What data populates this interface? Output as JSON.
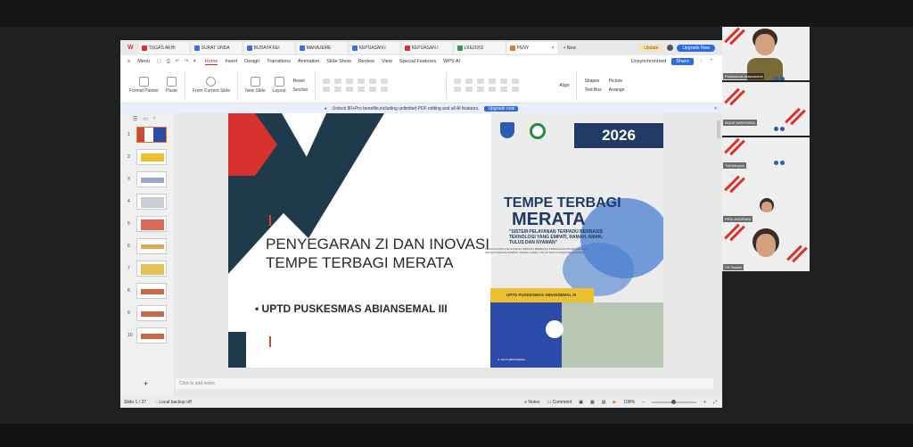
{
  "tabs": [
    {
      "label": "TUGAS AKHI",
      "color": "#d8322e"
    },
    {
      "label": "SURAT UNDA",
      "color": "#3b6fd8"
    },
    {
      "label": "BUDAYA KEI",
      "color": "#3b6fd8"
    },
    {
      "label": "MANAJEME",
      "color": "#3b6fd8"
    },
    {
      "label": "KEPUASAN I",
      "color": "#3b6fd8"
    },
    {
      "label": "KEPUASAN I",
      "color": "#d8322e"
    },
    {
      "label": "LKE2I202",
      "color": "#2aa05a"
    },
    {
      "label": "PENY",
      "color": "#e07a2a"
    }
  ],
  "new_tab_label": "New",
  "update_label": "Update",
  "upgrade_label": "Upgrade Now",
  "menu": {
    "items": [
      "Menu",
      "Home",
      "Insert",
      "Design",
      "Transitions",
      "Animation",
      "Slide Show",
      "Review",
      "View",
      "Special Features",
      "WPS AI"
    ],
    "active": "Home",
    "sync_status": "Unsynchronized",
    "share_label": "Share"
  },
  "ribbon": {
    "format_painter": "Format Painter",
    "paste": "Paste",
    "from_current_slide": "From Current Slide",
    "new_slide": "New Slide",
    "layout": "Layout",
    "reset": "Reset",
    "section": "Section",
    "shapes": "Shapes",
    "picture": "Picture",
    "text_box": "Text Box",
    "arrange": "Arrange",
    "align": "Align"
  },
  "promo": {
    "text": "Unlock 80+Pro benefits,including unlimited PDF editing and all AI features.",
    "button": "Upgrade now"
  },
  "thumbnails": [
    "1",
    "2",
    "3",
    "4",
    "5",
    "6",
    "7",
    "8",
    "9",
    "10"
  ],
  "slide": {
    "title": "PENYEGARAN ZI DAN INOVASI TEMPE TERBAGI MERATA",
    "bullet": "UPTD PUSKESMAS ABIANSEMAL III",
    "year": "2026",
    "poster_title_1": "TEMPE TERBAGI",
    "poster_title_2": "MERATA",
    "poster_subtitle": "\"SISTEM PELAYANAN TERPADU BERBASIS TEKNOLOGI YANG EMPATI, RAMAH, AMAN, TULUS DAN NYAMAN\"",
    "poster_small": "MERAKIA KINIA PELAYANAN TERPADU BERBASIS PERSAHAAN PASIEN DENGAN MENGUTAMAKAN EMPATI, RAMAH, AMAN, TULUS DAN NYAMAN BAGI PASIEN",
    "yellow_bar": "UPTD PUSKESMAS ABIANSEMAL III",
    "photo_caption": "Jl. RAYA ABIANSEMAL"
  },
  "notes_placeholder": "Click to add notes",
  "status": {
    "slide_count": "Slide 1 / 37",
    "backup": "Local backup off",
    "notes": "Notes",
    "comment": "Comment",
    "zoom": "108%"
  },
  "participants": [
    {
      "name": "Puskesmas Abiansemal"
    },
    {
      "name": "MADE WIDHYANA"
    },
    {
      "name": "Tuti Adnyani"
    },
    {
      "name": "PENI ANDRIANI"
    },
    {
      "name": "CR Swasti"
    }
  ]
}
